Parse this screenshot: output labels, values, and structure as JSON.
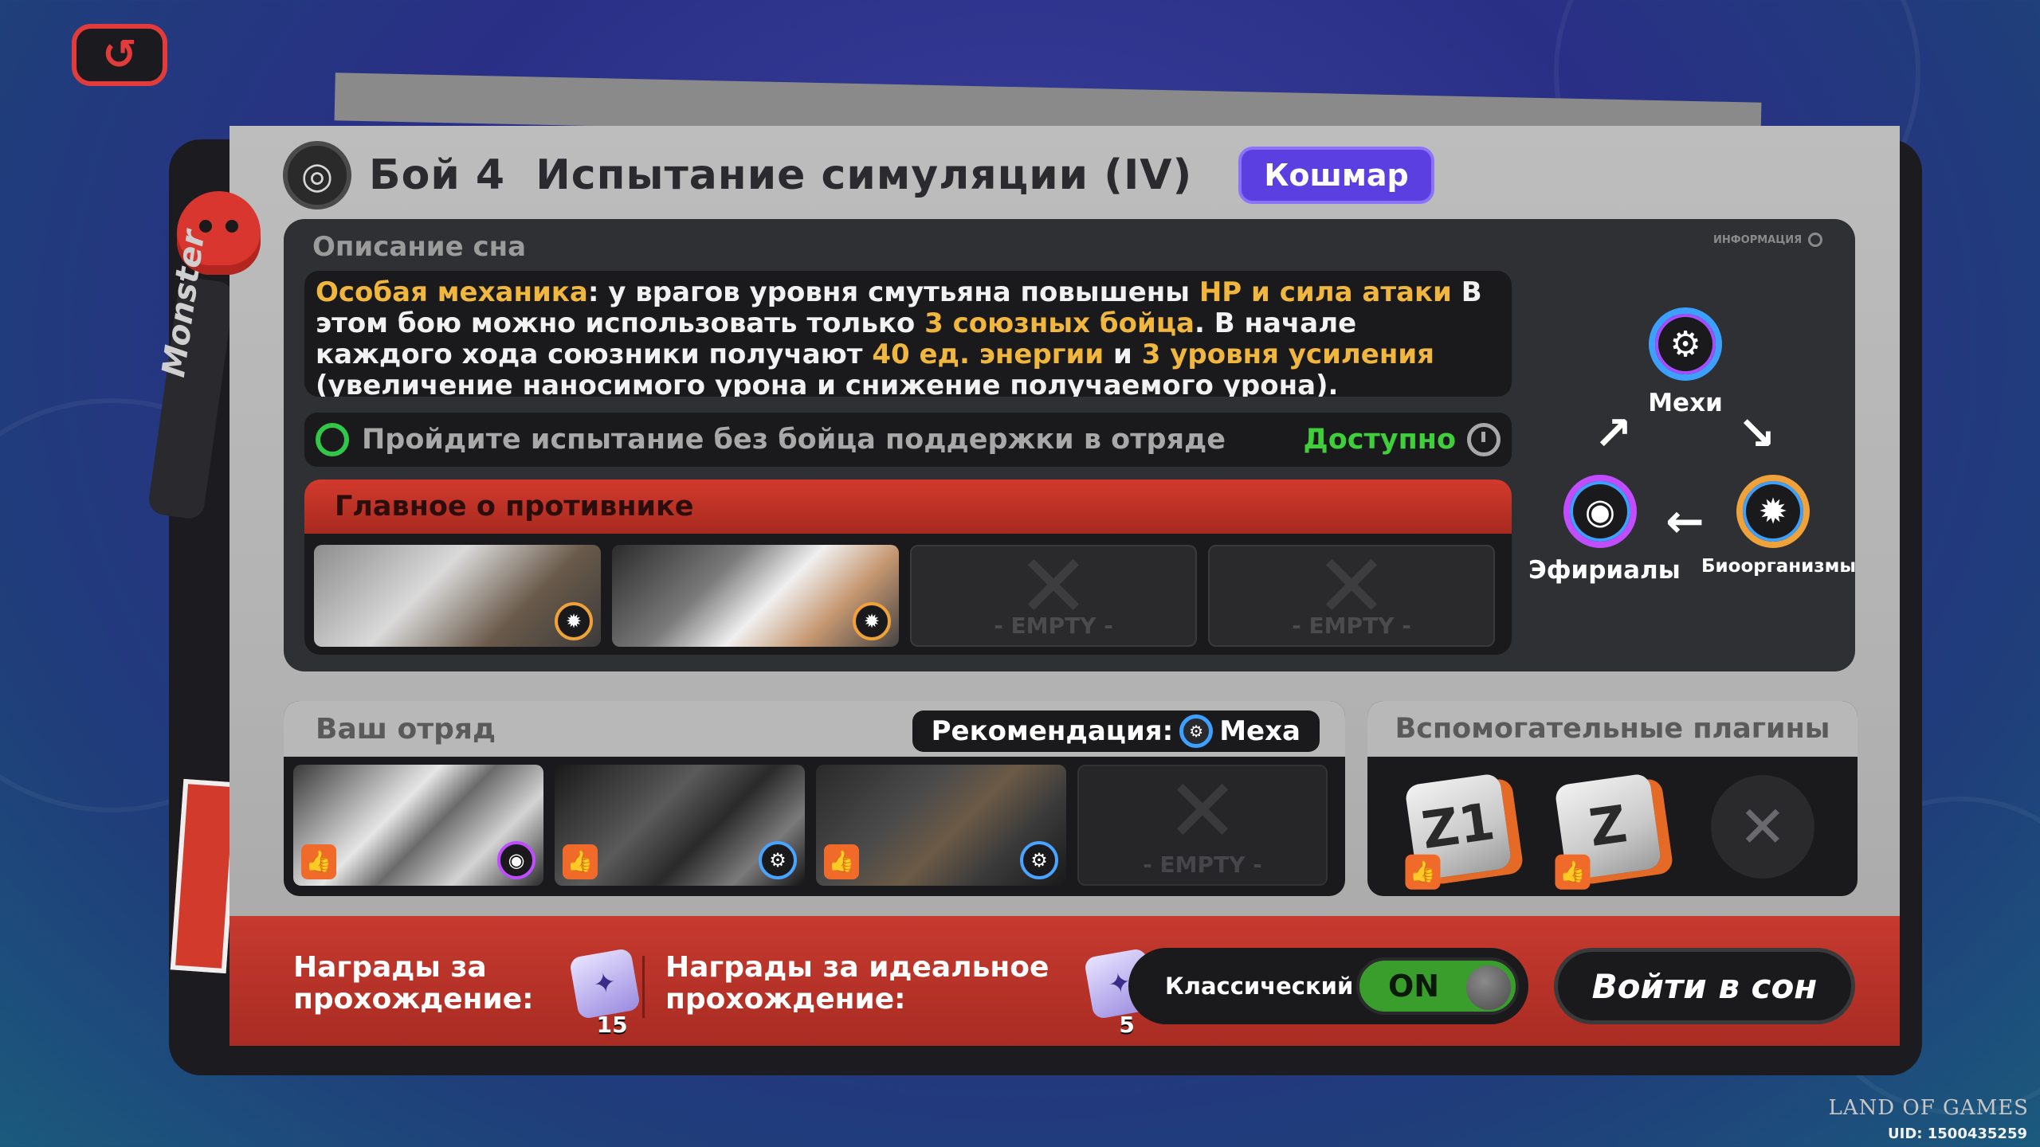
{
  "nav": {
    "back_icon": "back-arrow-icon"
  },
  "header": {
    "title": "Бой 4  Испытание симуляции (IV)",
    "difficulty": "Кошмар"
  },
  "description": {
    "label": "Описание сна",
    "info_label": "ИНФОРМАЦИЯ",
    "text_parts": [
      {
        "t": "Особая механика",
        "hl": true
      },
      {
        "t": ": у врагов уровня смутьяна повышены ",
        "hl": false
      },
      {
        "t": "HP и сила атаки",
        "hl": true
      },
      {
        "t": " В этом бою можно использовать только ",
        "hl": false
      },
      {
        "t": "3 союзных бойца",
        "hl": true
      },
      {
        "t": ". В начале каждого хода союзники получают ",
        "hl": false
      },
      {
        "t": "40 ед. энергии",
        "hl": true
      },
      {
        "t": " и ",
        "hl": false
      },
      {
        "t": "3 уровня усиления",
        "hl": true
      },
      {
        "t": " (увеличение наносимого урона и снижение получаемого урона).",
        "hl": false
      }
    ]
  },
  "challenge": {
    "text": "Пройдите испытание без бойца поддержки в отряде",
    "status": "Доступно"
  },
  "enemies": {
    "title": "Главное о противнике",
    "slots": [
      {
        "type": "filled",
        "faction": "bio"
      },
      {
        "type": "filled",
        "faction": "bio"
      },
      {
        "type": "empty",
        "label": "- EMPTY -"
      },
      {
        "type": "empty",
        "label": "- EMPTY -"
      }
    ]
  },
  "cycle": {
    "mech": "Мехи",
    "ethereal": "Эфириалы",
    "bio": "Биоорганизмы"
  },
  "squad": {
    "title": "Ваш отряд",
    "recommend_label": "Рекомендация:",
    "recommend_value": "Меха",
    "empty_label": "- EMPTY -"
  },
  "plugins": {
    "title": "Вспомогательные плагины",
    "items": [
      "Z1",
      "Z"
    ]
  },
  "rewards": {
    "clear_label_1": "Награды за",
    "clear_label_2": "прохождение:",
    "clear_count": "15",
    "perfect_label_1": "Награды за идеальное",
    "perfect_label_2": "прохождение:",
    "perfect_count": "5"
  },
  "mode": {
    "label": "Классический",
    "state": "ON"
  },
  "enter_button": "Войти в сон",
  "watermark": "LAND OF GAMES",
  "uid": "UID: 1500435259",
  "brand_tag": "Monster",
  "colors": {
    "highlight": "#f0b63e",
    "nightmare_badge": "#5b3fe0",
    "available": "#3ecf3a",
    "enemy_header": "#d23a2c",
    "toggle_on": "#3a9e2c"
  }
}
